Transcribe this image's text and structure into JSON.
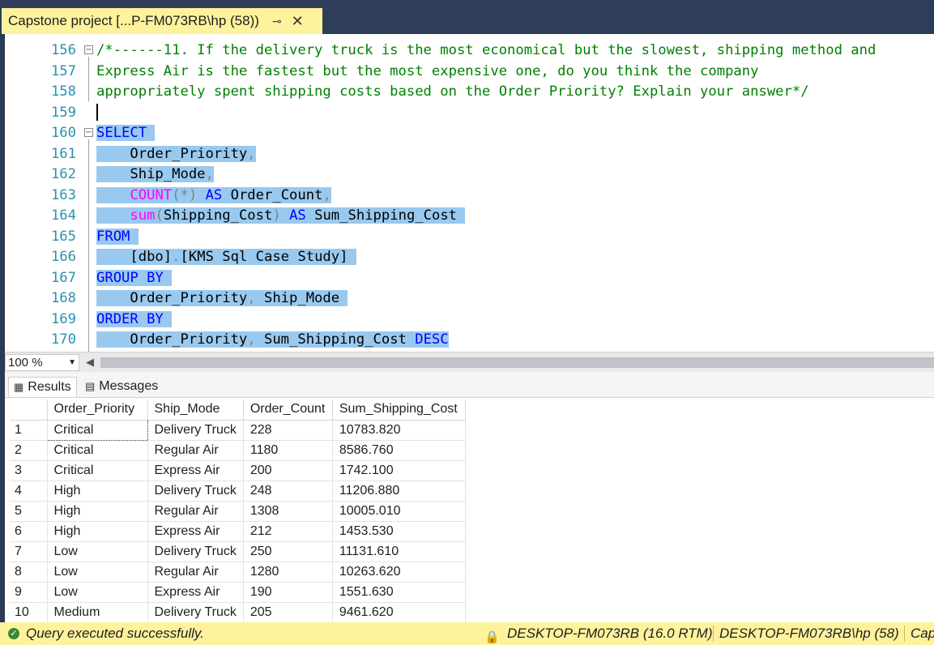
{
  "document_tab": {
    "title": "Capstone project [...P-FM073RB\\hp (58))",
    "pin_icon": "pin-icon",
    "close_icon": "close-icon",
    "close_glyph": "✕",
    "pin_glyph": "⊸"
  },
  "editor": {
    "lines": [
      {
        "num": "156",
        "text": "/*------11. If the delivery truck is the most economical but the slowest, shipping method and"
      },
      {
        "num": "157",
        "text": "Express Air is the fastest but the most expensive one, do you think the company"
      },
      {
        "num": "158",
        "text": "appropriately spent shipping costs based on the Order Priority? Explain your answer*/"
      },
      {
        "num": "159",
        "text": ""
      },
      {
        "num": "160",
        "kw": "SELECT"
      },
      {
        "num": "161",
        "a": "Order_Priority",
        "b": ","
      },
      {
        "num": "162",
        "a": "Ship_Mode",
        "b": ","
      },
      {
        "num": "163",
        "fn": "COUNT",
        "g1": "(*)",
        "kw": "AS",
        "a": "Order_Count",
        "b": ","
      },
      {
        "num": "164",
        "fn": "sum",
        "g1": "(",
        "a": "Shipping_Cost",
        "g2": ")",
        "kw": "AS",
        "c": "Sum_Shipping_Cost"
      },
      {
        "num": "165",
        "kw": "FROM"
      },
      {
        "num": "166",
        "a": "[dbo]",
        "g1": ".",
        "c": "[KMS Sql Case Study]"
      },
      {
        "num": "167",
        "kw": "GROUP BY"
      },
      {
        "num": "168",
        "a": "Order_Priority",
        "g1": ",",
        "c": "Ship_Mode"
      },
      {
        "num": "169",
        "kw": "ORDER BY"
      },
      {
        "num": "170",
        "a": "Order_Priority",
        "g1": ",",
        "c": "Sum_Shipping_Cost",
        "kw": "DESC"
      }
    ]
  },
  "zoom": {
    "value": "100 %"
  },
  "results_tabs": {
    "results": "Results",
    "messages": "Messages"
  },
  "grid": {
    "columns": [
      "Order_Priority",
      "Ship_Mode",
      "Order_Count",
      "Sum_Shipping_Cost"
    ],
    "rows": [
      [
        "1",
        "Critical",
        "Delivery Truck",
        "228",
        "10783.820"
      ],
      [
        "2",
        "Critical",
        "Regular Air",
        "1180",
        "8586.760"
      ],
      [
        "3",
        "Critical",
        "Express Air",
        "200",
        "1742.100"
      ],
      [
        "4",
        "High",
        "Delivery Truck",
        "248",
        "11206.880"
      ],
      [
        "5",
        "High",
        "Regular Air",
        "1308",
        "10005.010"
      ],
      [
        "6",
        "High",
        "Express Air",
        "212",
        "1453.530"
      ],
      [
        "7",
        "Low",
        "Delivery Truck",
        "250",
        "11131.610"
      ],
      [
        "8",
        "Low",
        "Regular Air",
        "1280",
        "10263.620"
      ],
      [
        "9",
        "Low",
        "Express Air",
        "190",
        "1551.630"
      ],
      [
        "10",
        "Medium",
        "Delivery Truck",
        "205",
        "9461.620"
      ]
    ]
  },
  "status": {
    "message": "Query executed successfully.",
    "server": "DESKTOP-FM073RB (16.0 RTM)",
    "user": "DESKTOP-FM073RB\\hp (58)",
    "database": "Cap"
  },
  "colors": {
    "tab_active": "#fff29d",
    "selection": "#99c9ef",
    "keyword": "#0000ff",
    "comment": "#008000",
    "function": "#ff00ff"
  }
}
